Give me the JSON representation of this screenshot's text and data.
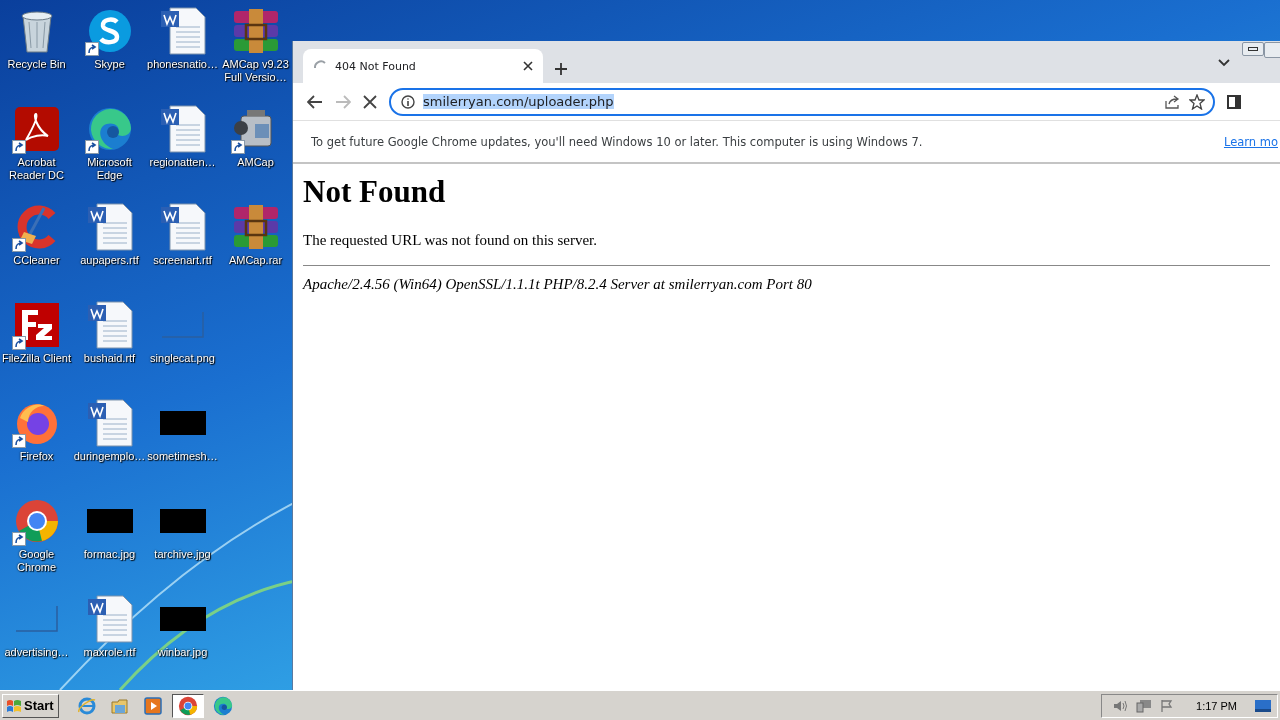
{
  "desktop": {
    "icons": [
      {
        "kind": "recycle",
        "label": "Recycle Bin",
        "shortcut": false
      },
      {
        "kind": "acrobat",
        "label": "Acrobat Reader DC",
        "shortcut": true
      },
      {
        "kind": "ccleaner",
        "label": "CCleaner",
        "shortcut": true
      },
      {
        "kind": "filezilla",
        "label": "FileZilla Client",
        "shortcut": true
      },
      {
        "kind": "firefox",
        "label": "Firefox",
        "shortcut": true
      },
      {
        "kind": "chrome",
        "label": "Google Chrome",
        "shortcut": true
      },
      {
        "kind": "blank",
        "label": "advertising…",
        "shortcut": false
      },
      {
        "kind": "skype",
        "label": "Skype",
        "shortcut": true
      },
      {
        "kind": "edge",
        "label": "Microsoft Edge",
        "shortcut": true
      },
      {
        "kind": "word",
        "label": "aupapers.rtf",
        "shortcut": false
      },
      {
        "kind": "word",
        "label": "bushaid.rtf",
        "shortcut": false
      },
      {
        "kind": "word",
        "label": "duringemplo…",
        "shortcut": false
      },
      {
        "kind": "dark",
        "label": "formac.jpg",
        "shortcut": false
      },
      {
        "kind": "word",
        "label": "maxrole.rtf",
        "shortcut": false
      },
      {
        "kind": "word",
        "label": "phonesnatio…",
        "shortcut": false
      },
      {
        "kind": "word",
        "label": "regionatten…",
        "shortcut": false
      },
      {
        "kind": "word",
        "label": "screenart.rtf",
        "shortcut": false
      },
      {
        "kind": "blank",
        "label": "singlecat.png",
        "shortcut": false
      },
      {
        "kind": "dark",
        "label": "sometimesh…",
        "shortcut": false
      },
      {
        "kind": "dark",
        "label": "tarchive.jpg",
        "shortcut": false
      },
      {
        "kind": "dark",
        "label": "winbar.jpg",
        "shortcut": false
      },
      {
        "kind": "winrar",
        "label": "AMCap v9.23 Full Versio…",
        "shortcut": false
      },
      {
        "kind": "camera",
        "label": "AMCap",
        "shortcut": true
      },
      {
        "kind": "winrar",
        "label": "AMCap.rar",
        "shortcut": false
      }
    ]
  },
  "browser": {
    "tab": {
      "title": "404 Not Found",
      "loading": true
    },
    "address": {
      "url": "smilerryan.com/uploader.php",
      "selected": true
    },
    "infobar": {
      "message": "To get future Google Chrome updates, you'll need Windows 10 or later. This computer is using Windows 7.",
      "link": "Learn mo"
    },
    "page": {
      "heading": "Not Found",
      "text": "The requested URL was not found on this server.",
      "server": "Apache/2.4.56 (Win64) OpenSSL/1.1.1t PHP/8.2.4 Server at smilerryan.com Port 80"
    }
  },
  "taskbar": {
    "start": "Start",
    "apps": [
      {
        "kind": "ie",
        "selected": false
      },
      {
        "kind": "explorer",
        "selected": false
      },
      {
        "kind": "media",
        "selected": false
      },
      {
        "kind": "chrome",
        "selected": true
      },
      {
        "kind": "edge",
        "selected": false
      }
    ],
    "clock": "1:17 PM"
  }
}
